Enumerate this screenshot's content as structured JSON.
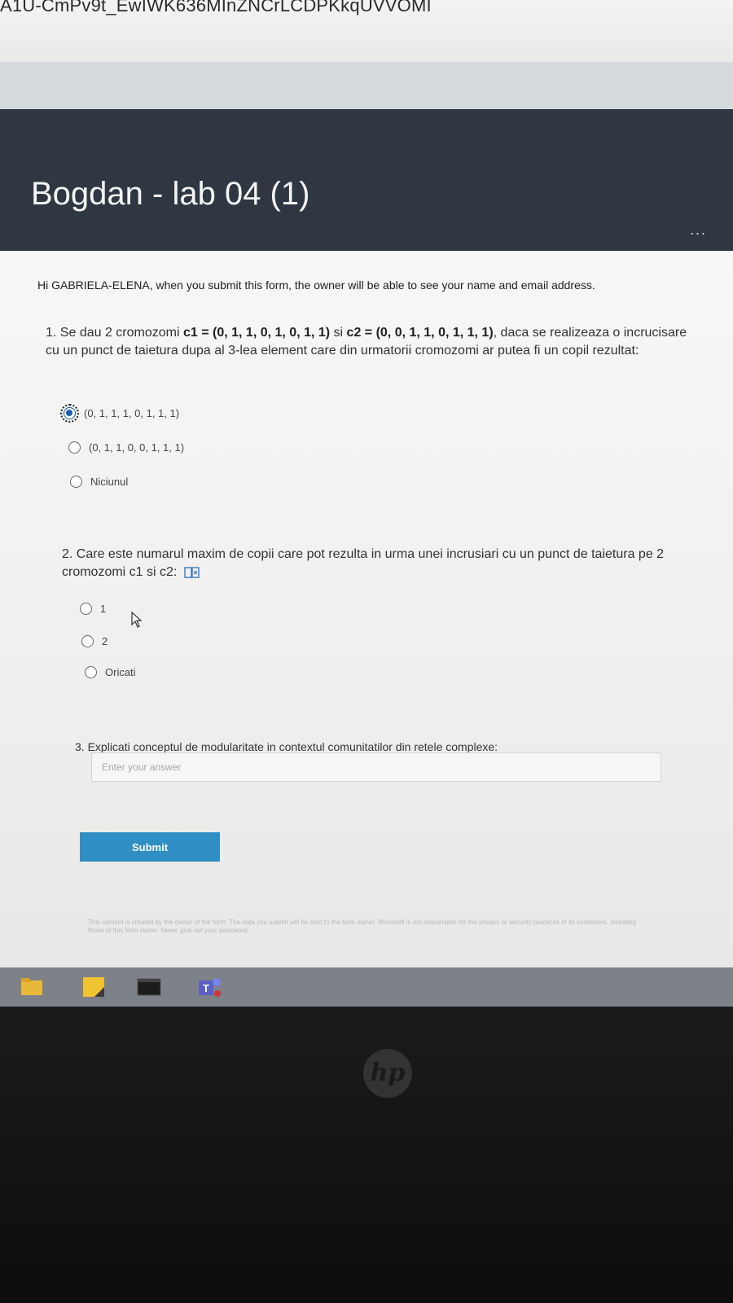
{
  "browser": {
    "url_visible": "A1U-CmPv9t_EwIWK636MInZNCrLCDPKkqUVVOMI"
  },
  "form": {
    "title": "Bogdan - lab 04 (1)",
    "more_menu": "...",
    "notice": "Hi GABRIELA-ELENA, when you submit this form, the owner will be able to see your name and email address.",
    "questions": [
      {
        "number": "1.",
        "text_line1": "Se dau 2 cromozomi ",
        "c1_label": "c1",
        "c1_value": " = (0, 1, 1, 0, 1, 0, 1, 1) ",
        "si": "si ",
        "c2_label": "c2",
        "c2_value": " = (0, 0, 1, 1, 0, 1, 1, 1)",
        "text_rest": ", daca se realizeaza o incrucisare cu un punct de taietura dupa al 3-lea element care din urmatorii cromozomi ar putea fi un copil rezultat:",
        "options": [
          "(0, 1, 1, 1, 0, 1, 1, 1)",
          "(0, 1, 1, 0, 0, 1, 1, 1)",
          "Niciunul"
        ],
        "selected_index": 0
      },
      {
        "number": "2.",
        "text": "Care este numarul maxim de copii care pot rezulta in urma unei incrusiari cu un punct de taietura pe 2 cromozomi c1 si c2:",
        "options": [
          "1",
          "2",
          "Oricati"
        ],
        "selected_index": null
      },
      {
        "number": "3.",
        "text": "Explicati conceptul de modularitate in contextul comunitatilor din retele complexe:",
        "answer_placeholder": "Enter your answer",
        "answer_value": ""
      }
    ],
    "submit_label": "Submit",
    "disclaimer": "This content is created by the owner of the form. The data you submit will be sent to the form owner. Microsoft is not responsible for the privacy or security practices of its customers, including those of this form owner. Never give out your password."
  },
  "taskbar": {
    "icons": [
      "file-explorer-icon",
      "sticky-notes-icon",
      "terminal-icon",
      "teams-icon"
    ]
  },
  "colors": {
    "header_bg": "#2f3742",
    "accent": "#2f8fc5",
    "form_bg": "#f4f4f3",
    "taskbar_bg": "#7d8188"
  }
}
